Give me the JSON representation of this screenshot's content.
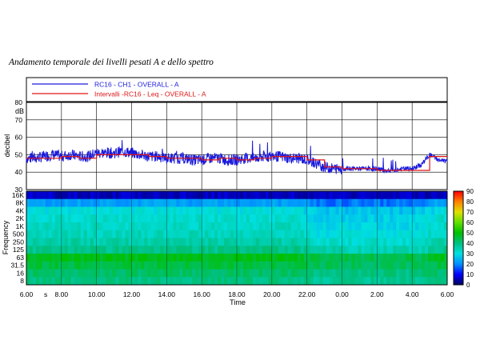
{
  "page_title": "Andamento temporale dei livelli pesati A e dello spettro",
  "chart_data": [
    {
      "type": "line",
      "legend": [
        {
          "label": "RC16 - CH1 - OVERALL - A",
          "color": "#1a1adc"
        },
        {
          "label": "Intervalli -RC16 - Leq - OVERALL - A",
          "color": "#e01414"
        }
      ],
      "legend_placement": "top",
      "xlabel": "Time",
      "ylabel": "decibel",
      "yunit": "dB",
      "ylim": [
        30,
        80
      ],
      "yticks": [
        "30",
        "40",
        "50",
        "60",
        "70",
        "80"
      ],
      "grid": true,
      "series": [
        {
          "name": "RC16 - CH1 - OVERALL - A",
          "color": "#1a1adc",
          "x": [
            "6.00",
            "6.50",
            "7.00",
            "7.50",
            "8.00",
            "8.50",
            "9.00",
            "9.50",
            "10.00",
            "10.50",
            "11.00",
            "11.50",
            "12.00",
            "12.50",
            "13.00",
            "13.50",
            "14.00",
            "14.50",
            "15.00",
            "15.50",
            "16.00",
            "16.50",
            "17.00",
            "17.50",
            "18.00",
            "18.50",
            "19.00",
            "19.50",
            "20.00",
            "20.50",
            "21.00",
            "21.50",
            "22.00",
            "22.50",
            "23.00",
            "23.50",
            "0.00",
            "0.50",
            "1.00",
            "1.50",
            "2.00",
            "2.50",
            "3.00",
            "3.50",
            "4.00",
            "4.50",
            "5.00",
            "5.50",
            "6.00"
          ],
          "values": [
            48,
            48,
            49,
            50,
            49,
            50,
            49,
            49,
            51,
            51,
            51,
            52,
            51,
            50,
            49,
            49,
            48,
            48,
            48,
            47,
            47,
            48,
            48,
            47,
            47,
            48,
            48,
            49,
            49,
            49,
            48,
            48,
            47,
            45,
            43,
            42,
            42,
            42,
            42,
            42,
            42,
            41,
            41,
            42,
            42,
            44,
            50,
            47,
            46
          ]
        },
        {
          "name": "Intervalli -RC16 - Leq - OVERALL - A",
          "color": "#e01414",
          "x": [
            "6.00",
            "7.00",
            "8.00",
            "9.00",
            "10.00",
            "11.00",
            "12.00",
            "13.00",
            "14.00",
            "15.00",
            "16.00",
            "17.00",
            "18.00",
            "19.00",
            "20.00",
            "21.00",
            "22.00",
            "23.00",
            "0.00",
            "1.00",
            "2.00",
            "3.00",
            "4.00",
            "5.00"
          ],
          "values": [
            48,
            48,
            49,
            48,
            50,
            50,
            50,
            49,
            48,
            48,
            47,
            48,
            47,
            48,
            49,
            49,
            47,
            43,
            42,
            42,
            41,
            41,
            41,
            49
          ]
        }
      ]
    },
    {
      "type": "heatmap",
      "xlabel": "Time",
      "ylabel": "Frequency",
      "xticks": [
        "6.00",
        "s",
        "8.00",
        "10.00",
        "12.00",
        "14.00",
        "16.00",
        "18.00",
        "20.00",
        "22.00",
        "0.00",
        "2.00",
        "4.00",
        "6.00"
      ],
      "yticks": [
        "16K",
        "8K",
        "4K",
        "2K",
        "1K",
        "500",
        "250",
        "125",
        "63",
        "31.5",
        "16",
        "8"
      ],
      "colorbar": {
        "ticks": [
          "0",
          "10",
          "20",
          "30",
          "40",
          "50",
          "60",
          "70",
          "80",
          "90"
        ],
        "range": [
          0,
          90
        ],
        "colors": [
          "#000060",
          "#0000ff",
          "#0090ff",
          "#00e0e0",
          "#00c080",
          "#00c000",
          "#60e000",
          "#e0e000",
          "#ff8000",
          "#ff0000"
        ]
      },
      "band_levels": [
        {
          "band": "16K",
          "day": 6,
          "night": 6
        },
        {
          "band": "8K",
          "day": 22,
          "night": 18
        },
        {
          "band": "4K",
          "day": 30,
          "night": 26
        },
        {
          "band": "2K",
          "day": 32,
          "night": 28
        },
        {
          "band": "1K",
          "day": 33,
          "night": 29
        },
        {
          "band": "500",
          "day": 34,
          "night": 30
        },
        {
          "band": "250",
          "day": 36,
          "night": 32
        },
        {
          "band": "125",
          "day": 39,
          "night": 35
        },
        {
          "band": "63",
          "day": 48,
          "night": 44
        },
        {
          "band": "31.5",
          "day": 45,
          "night": 43
        },
        {
          "band": "16",
          "day": 42,
          "night": 40
        },
        {
          "band": "8",
          "day": 40,
          "night": 38
        }
      ]
    }
  ]
}
